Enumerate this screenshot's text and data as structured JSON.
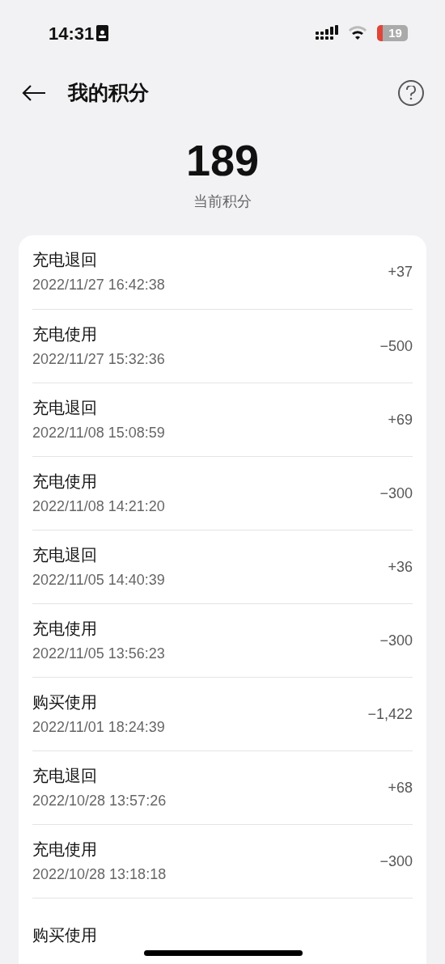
{
  "status_bar": {
    "time": "14:31",
    "battery": "19"
  },
  "header": {
    "title": "我的积分"
  },
  "summary": {
    "points": "189",
    "label": "当前积分"
  },
  "records": [
    {
      "title": "充电退回",
      "time": "2022/11/27 16:42:38",
      "amount": "+37"
    },
    {
      "title": "充电使用",
      "time": "2022/11/27 15:32:36",
      "amount": "−500"
    },
    {
      "title": "充电退回",
      "time": "2022/11/08 15:08:59",
      "amount": "+69"
    },
    {
      "title": "充电使用",
      "time": "2022/11/08 14:21:20",
      "amount": "−300"
    },
    {
      "title": "充电退回",
      "time": "2022/11/05 14:40:39",
      "amount": "+36"
    },
    {
      "title": "充电使用",
      "time": "2022/11/05 13:56:23",
      "amount": "−300"
    },
    {
      "title": "购买使用",
      "time": "2022/11/01 18:24:39",
      "amount": "−1,422"
    },
    {
      "title": "充电退回",
      "time": "2022/10/28 13:57:26",
      "amount": "+68"
    },
    {
      "title": "充电使用",
      "time": "2022/10/28 13:18:18",
      "amount": "−300"
    },
    {
      "title": "购买使用"
    }
  ]
}
